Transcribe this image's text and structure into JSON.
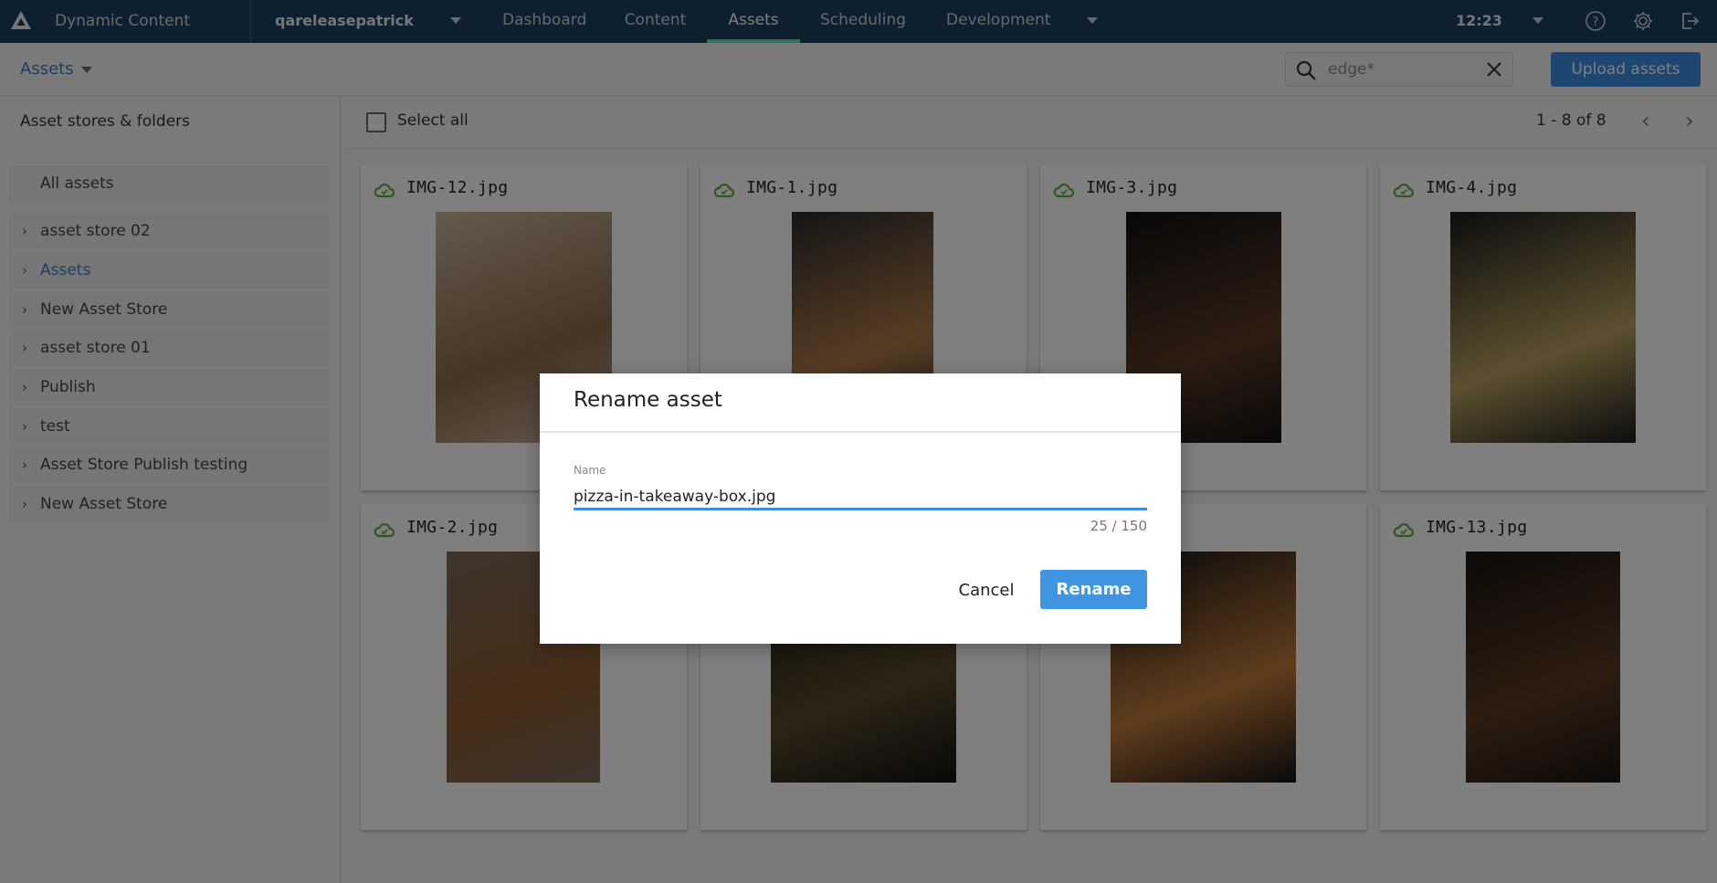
{
  "topbar": {
    "app_title": "Dynamic Content",
    "hub_name": "qareleasepatrick",
    "tabs": [
      {
        "label": "Dashboard",
        "active": false
      },
      {
        "label": "Content",
        "active": false
      },
      {
        "label": "Assets",
        "active": true
      },
      {
        "label": "Scheduling",
        "active": false
      },
      {
        "label": "Development",
        "active": false
      }
    ],
    "time": "12:23",
    "icons": [
      "help-icon",
      "gear-icon",
      "logout-icon"
    ]
  },
  "subbar": {
    "breadcrumb": "Assets",
    "search": {
      "value": "edge*",
      "placeholder": "Search"
    },
    "upload_label": "Upload assets"
  },
  "sidebar": {
    "title": "Asset stores & folders",
    "all_assets": "All assets",
    "items": [
      {
        "label": "asset store 02",
        "selected": false
      },
      {
        "label": "Assets",
        "selected": true
      },
      {
        "label": "New Asset Store",
        "selected": false
      },
      {
        "label": "asset store 01",
        "selected": false
      },
      {
        "label": "Publish",
        "selected": false
      },
      {
        "label": "test",
        "selected": false
      },
      {
        "label": "Asset Store Publish testing",
        "selected": false
      },
      {
        "label": "New Asset Store",
        "selected": false
      }
    ]
  },
  "toolbar": {
    "select_all": "Select all",
    "pager": "1 - 8 of 8"
  },
  "assets": [
    {
      "name": "IMG-12.jpg",
      "status": "published",
      "colors": [
        "#c9b49a",
        "#8a6a4a"
      ]
    },
    {
      "name": "IMG-1.jpg",
      "status": "published",
      "colors": [
        "#2a2a2a",
        "#b07a4a"
      ]
    },
    {
      "name": "IMG-3.jpg",
      "status": "published",
      "colors": [
        "#111111",
        "#5a3a24"
      ]
    },
    {
      "name": "IMG-4.jpg",
      "status": "published",
      "colors": [
        "#1a1a1a",
        "#b8a060"
      ]
    },
    {
      "name": "IMG-2.jpg",
      "status": "published",
      "colors": [
        "#7a6a5a",
        "#8c5a30"
      ]
    },
    {
      "name": "",
      "status": "",
      "colors": [
        "#111111",
        "#5a4a2a"
      ]
    },
    {
      "name": "",
      "status": "",
      "colors": [
        "#141414",
        "#c07a3a"
      ]
    },
    {
      "name": "IMG-13.jpg",
      "status": "published",
      "colors": [
        "#1a1410",
        "#5a3a20"
      ]
    }
  ],
  "modal": {
    "title": "Rename asset",
    "field_label": "Name",
    "field_value": "pizza-in-takeaway-box.jpg",
    "counter": "25 / 150",
    "cancel_label": "Cancel",
    "rename_label": "Rename"
  },
  "colors": {
    "topbar": "#1c3f5f",
    "accent": "#3a8ee0",
    "active_tab": "#6fe0bd",
    "status_green": "#5fae3e"
  }
}
